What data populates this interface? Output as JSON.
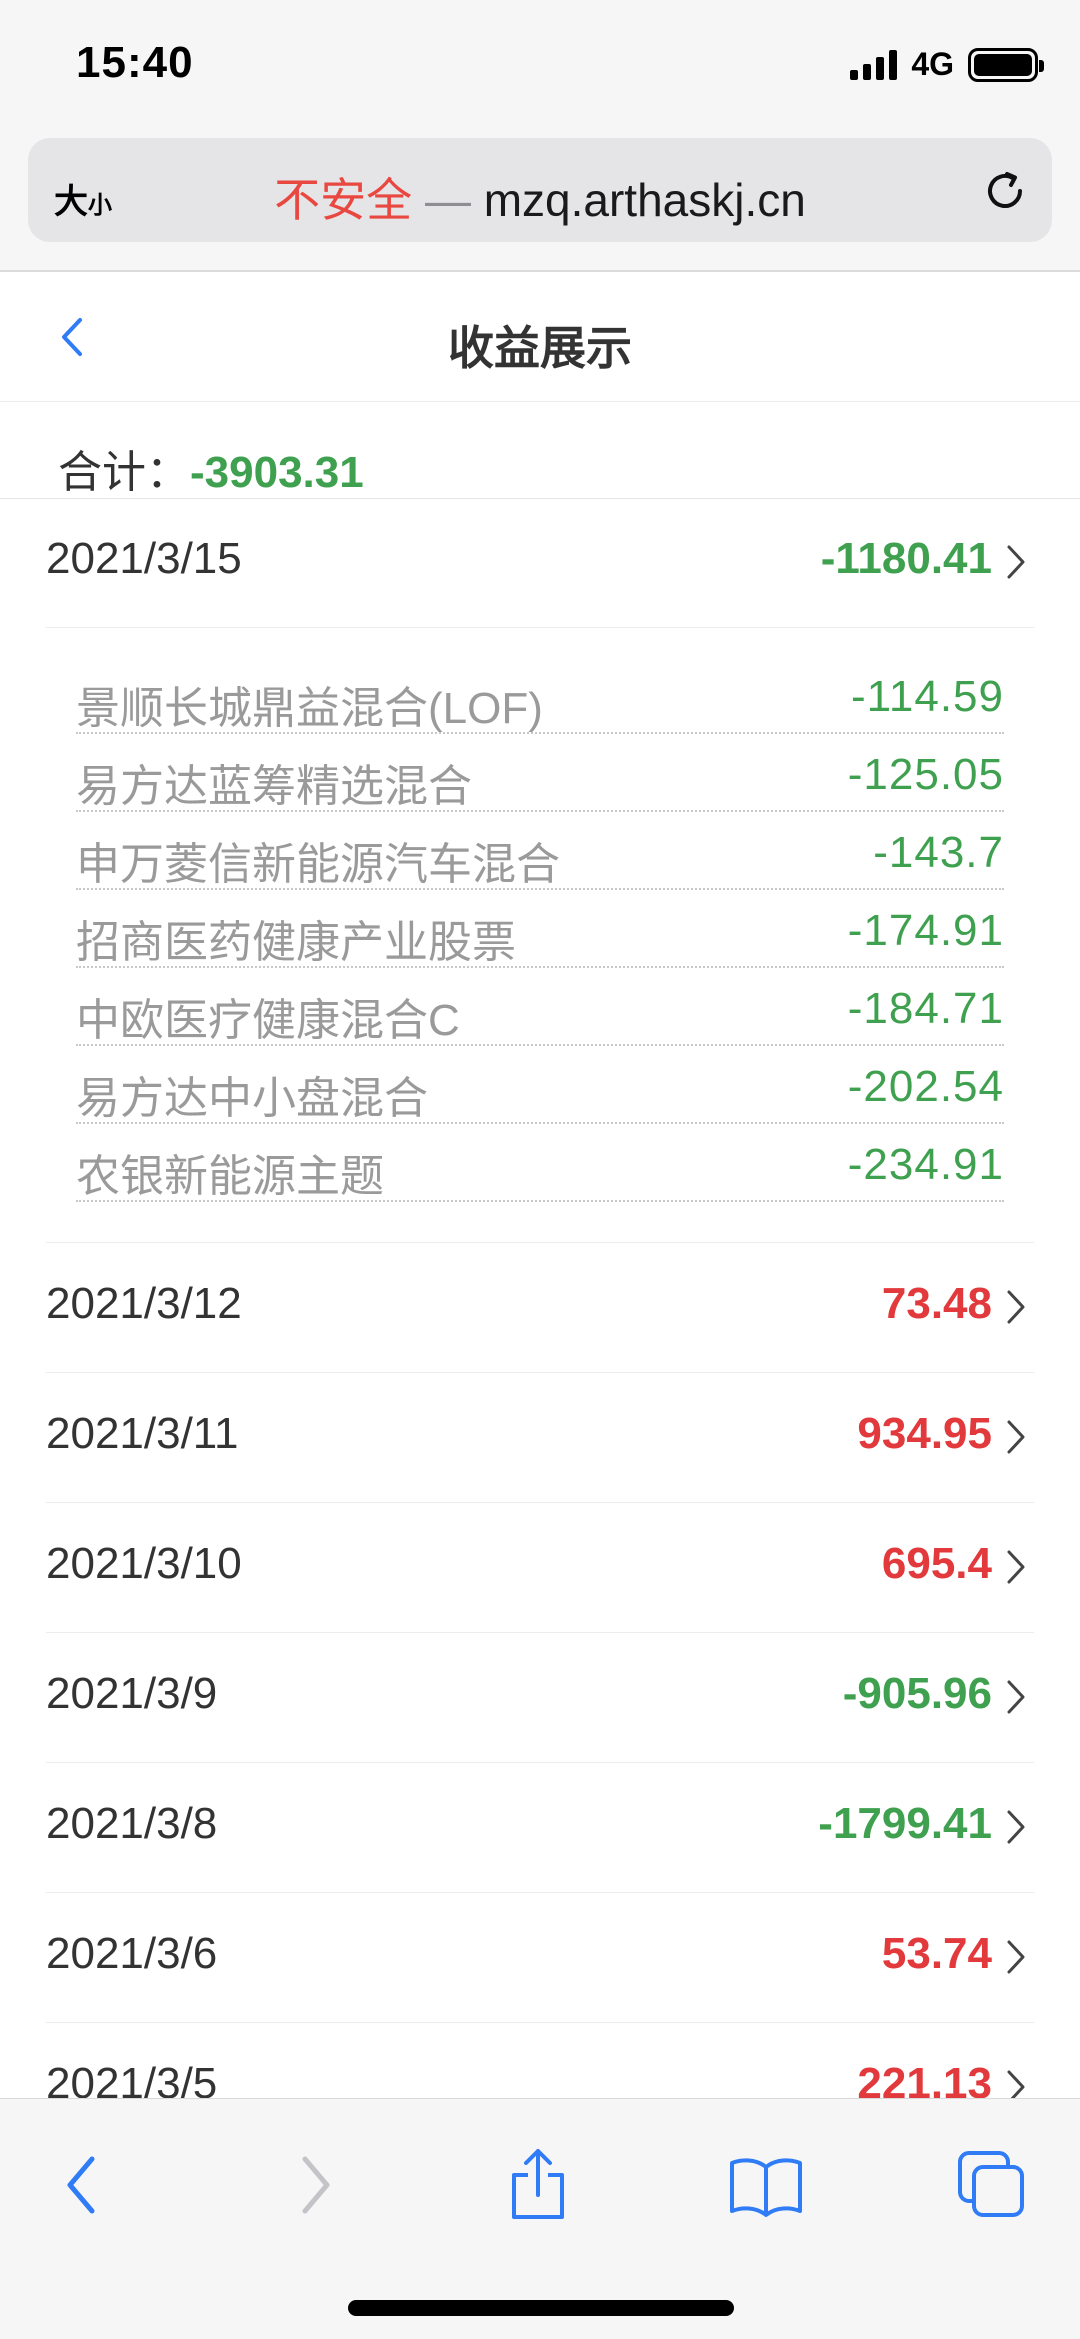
{
  "status_bar": {
    "time": "15:40",
    "network": "4G"
  },
  "browser": {
    "text_size_big": "大",
    "text_size_small": "小",
    "insecure_label": "不安全",
    "separator": "—",
    "domain": "mzq.arthaskj.cn"
  },
  "header": {
    "title": "收益展示"
  },
  "summary": {
    "label": "合计：",
    "value": "-3903.31"
  },
  "colors": {
    "negative": "#3fa14f",
    "positive": "#e2393c",
    "insecure": "#e8483f",
    "ios_blue": "#2f7cf6"
  },
  "rows": [
    {
      "date": "2021/3/15",
      "value": "-1180.41",
      "sign": "neg",
      "funds": [
        {
          "name": "景顺长城鼎益混合(LOF)",
          "value": "-114.59"
        },
        {
          "name": "易方达蓝筹精选混合",
          "value": "-125.05"
        },
        {
          "name": "申万菱信新能源汽车混合",
          "value": "-143.7"
        },
        {
          "name": "招商医药健康产业股票",
          "value": "-174.91"
        },
        {
          "name": "中欧医疗健康混合C",
          "value": "-184.71"
        },
        {
          "name": "易方达中小盘混合",
          "value": "-202.54"
        },
        {
          "name": "农银新能源主题",
          "value": "-234.91"
        }
      ]
    },
    {
      "date": "2021/3/12",
      "value": "73.48",
      "sign": "pos"
    },
    {
      "date": "2021/3/11",
      "value": "934.95",
      "sign": "pos"
    },
    {
      "date": "2021/3/10",
      "value": "695.4",
      "sign": "pos"
    },
    {
      "date": "2021/3/9",
      "value": "-905.96",
      "sign": "neg"
    },
    {
      "date": "2021/3/8",
      "value": "-1799.41",
      "sign": "neg"
    },
    {
      "date": "2021/3/6",
      "value": "53.74",
      "sign": "pos"
    },
    {
      "date": "2021/3/5",
      "value": "221.13",
      "sign": "pos"
    }
  ],
  "toolbar": {
    "icons": [
      "back-icon",
      "forward-icon",
      "share-icon",
      "bookmarks-icon",
      "tabs-icon"
    ]
  }
}
